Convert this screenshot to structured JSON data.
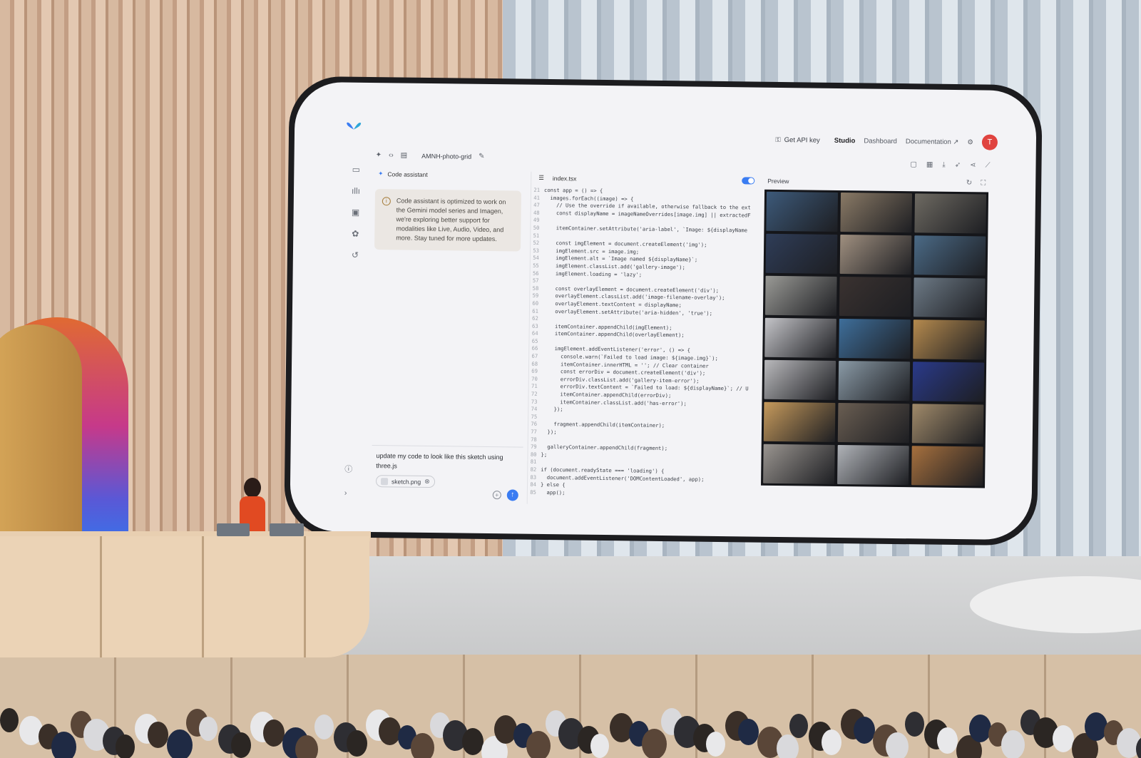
{
  "app": {
    "nav": {
      "api_key_label": "Get API key",
      "studio_label": "Studio",
      "dashboard_label": "Dashboard",
      "documentation_label": "Documentation",
      "avatar_initial": "T"
    },
    "project": {
      "name": "AMNH-photo-grid"
    },
    "assistant": {
      "title": "Code assistant",
      "notice": "Code assistant is optimized to work on the Gemini model series and Imagen, we're exploring better support for modalities like Live, Audio, Video, and more. Stay tuned for more updates.",
      "prompt_text": "update my code to look like this sketch using three.js",
      "attachment": "sketch.png"
    },
    "editor": {
      "file_tab": "index.tsx",
      "lines": [
        {
          "n": "21",
          "t": "const app = () => {"
        },
        {
          "n": "41",
          "t": "  images.forEach((image) => {"
        },
        {
          "n": "47",
          "t": "    // Use the override if available, otherwise fallback to the ext"
        },
        {
          "n": "48",
          "t": "    const displayName = imageNameOverrides[image.img] || extractedF"
        },
        {
          "n": "49",
          "t": ""
        },
        {
          "n": "50",
          "t": "    itemContainer.setAttribute('aria-label', `Image: ${displayName"
        },
        {
          "n": "51",
          "t": ""
        },
        {
          "n": "52",
          "t": "    const imgElement = document.createElement('img');"
        },
        {
          "n": "53",
          "t": "    imgElement.src = image.img;"
        },
        {
          "n": "54",
          "t": "    imgElement.alt = `Image named ${displayName}`;"
        },
        {
          "n": "55",
          "t": "    imgElement.classList.add('gallery-image');"
        },
        {
          "n": "56",
          "t": "    imgElement.loading = 'lazy';"
        },
        {
          "n": "57",
          "t": ""
        },
        {
          "n": "58",
          "t": "    const overlayElement = document.createElement('div');"
        },
        {
          "n": "59",
          "t": "    overlayElement.classList.add('image-filename-overlay');"
        },
        {
          "n": "60",
          "t": "    overlayElement.textContent = displayName;"
        },
        {
          "n": "61",
          "t": "    overlayElement.setAttribute('aria-hidden', 'true');"
        },
        {
          "n": "62",
          "t": ""
        },
        {
          "n": "63",
          "t": "    itemContainer.appendChild(imgElement);"
        },
        {
          "n": "64",
          "t": "    itemContainer.appendChild(overlayElement);"
        },
        {
          "n": "65",
          "t": ""
        },
        {
          "n": "66",
          "t": "    imgElement.addEventListener('error', () => {"
        },
        {
          "n": "67",
          "t": "      console.warn(`Failed to load image: ${image.img}`);"
        },
        {
          "n": "68",
          "t": "      itemContainer.innerHTML = ''; // Clear container"
        },
        {
          "n": "69",
          "t": "      const errorDiv = document.createElement('div');"
        },
        {
          "n": "70",
          "t": "      errorDiv.classList.add('gallery-item-error');"
        },
        {
          "n": "71",
          "t": "      errorDiv.textContent = `Failed to load: ${displayName}`; // U"
        },
        {
          "n": "72",
          "t": "      itemContainer.appendChild(errorDiv);"
        },
        {
          "n": "73",
          "t": "      itemContainer.classList.add('has-error');"
        },
        {
          "n": "74",
          "t": "    });"
        },
        {
          "n": "75",
          "t": ""
        },
        {
          "n": "76",
          "t": "    fragment.appendChild(itemContainer);"
        },
        {
          "n": "77",
          "t": "  });"
        },
        {
          "n": "78",
          "t": ""
        },
        {
          "n": "79",
          "t": "  galleryContainer.appendChild(fragment);"
        },
        {
          "n": "80",
          "t": "};"
        },
        {
          "n": "81",
          "t": ""
        },
        {
          "n": "82",
          "t": "if (document.readyState === 'loading') {"
        },
        {
          "n": "83",
          "t": "  document.addEventListener('DOMContentLoaded', app);"
        },
        {
          "n": "84",
          "t": "} else {"
        },
        {
          "n": "85",
          "t": "  app();"
        }
      ]
    },
    "preview": {
      "title": "Preview",
      "tiles": [
        "#3d5a7a",
        "#8a7a66",
        "#6e6a62",
        "#2f3d58",
        "#a09080",
        "#4b6a86",
        "#9a9a96",
        "#3a3230",
        "#6d7a86",
        "#c4c4c8",
        "#3e6e9a",
        "#b58a4e",
        "#b9b9bc",
        "#8a9aa6",
        "#2a3a8a",
        "#c69a5c",
        "#6a5e52",
        "#a08a6a",
        "#9a9590",
        "#b0b3b8",
        "#a6703e"
      ]
    }
  }
}
